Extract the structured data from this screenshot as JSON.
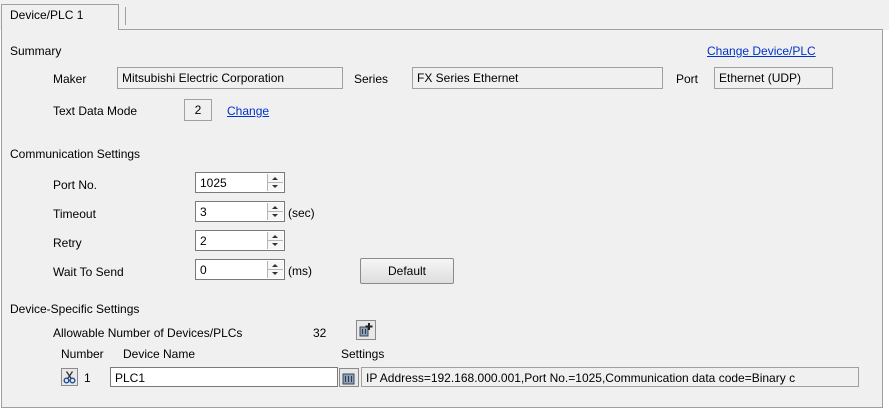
{
  "tab": {
    "label": "Device/PLC 1"
  },
  "summary": {
    "title": "Summary",
    "change_device_link": "Change Device/PLC",
    "maker_label": "Maker",
    "maker_value": "Mitsubishi Electric Corporation",
    "series_label": "Series",
    "series_value": "FX Series Ethernet",
    "port_label": "Port",
    "port_value": "Ethernet (UDP)",
    "text_mode_label": "Text Data Mode",
    "text_mode_value": "2",
    "text_mode_change": "Change"
  },
  "comm": {
    "title": "Communication Settings",
    "port_label": "Port No.",
    "port_value": "1025",
    "timeout_label": "Timeout",
    "timeout_value": "3",
    "timeout_unit": "(sec)",
    "retry_label": "Retry",
    "retry_value": "2",
    "wait_label": "Wait To Send",
    "wait_value": "0",
    "wait_unit": "(ms)",
    "default_button": "Default"
  },
  "device_specific": {
    "title": "Device-Specific Settings",
    "allowable_label": "Allowable Number of Devices/PLCs",
    "allowable_value": "32",
    "number_header": "Number",
    "device_name_header": "Device Name",
    "settings_header": "Settings",
    "row": {
      "number": "1",
      "device_name": "PLC1",
      "settings": "IP Address=192.168.000.001,Port No.=1025,Communication data code=Binary c"
    }
  },
  "colors": {
    "link": "#0033cc",
    "panel": "#f0f0f0"
  },
  "icons": [
    "spin-up-icon",
    "spin-down-icon",
    "add-device-icon",
    "device-settings-icon",
    "delete-device-icon"
  ]
}
